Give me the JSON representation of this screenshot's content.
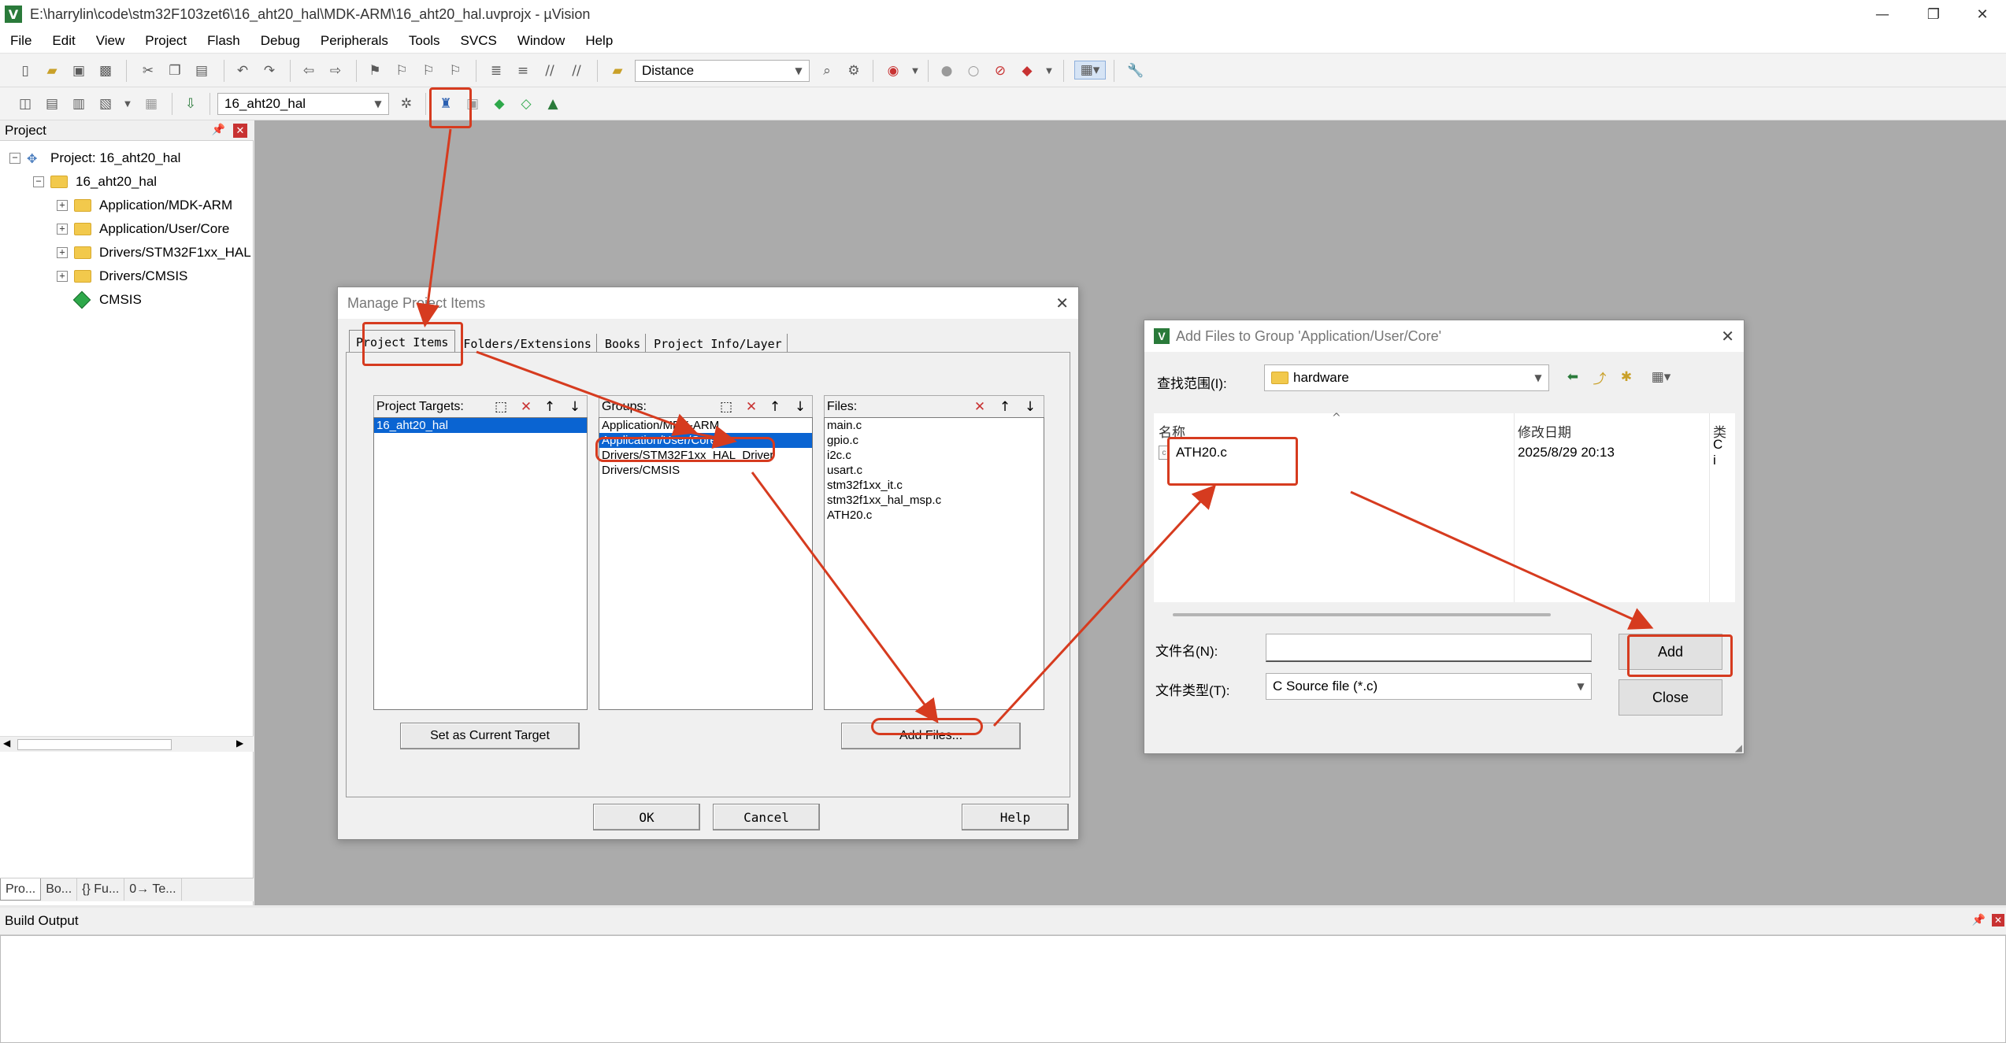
{
  "window": {
    "title": "E:\\harrylin\\code\\stm32F103zet6\\16_aht20_hal\\MDK-ARM\\16_aht20_hal.uvprojx - µVision",
    "minimize": "—",
    "restore": "❐",
    "close": "✕"
  },
  "menu": [
    "File",
    "Edit",
    "View",
    "Project",
    "Flash",
    "Debug",
    "Peripherals",
    "Tools",
    "SVCS",
    "Window",
    "Help"
  ],
  "toolbar1": {
    "find_combo": "Distance"
  },
  "toolbar2": {
    "target_combo": "16_aht20_hal"
  },
  "project_panel": {
    "title": "Project",
    "tree": {
      "root": "Project: 16_aht20_hal",
      "target": "16_aht20_hal",
      "groups": [
        "Application/MDK-ARM",
        "Application/User/Core",
        "Drivers/STM32F1xx_HAL",
        "Drivers/CMSIS"
      ],
      "component": "CMSIS"
    },
    "tabs": [
      "Pro...",
      "Bo...",
      "{} Fu...",
      "0→ Te..."
    ]
  },
  "build_output": {
    "title": "Build Output"
  },
  "manage_dialog": {
    "title": "Manage Project Items",
    "tabs": [
      "Project Items",
      "Folders/Extensions",
      "Books",
      "Project Info/Layer"
    ],
    "targets_label": "Project Targets:",
    "groups_label": "Groups:",
    "files_label": "Files:",
    "targets": [
      "16_aht20_hal"
    ],
    "groups": [
      "Application/MDK-ARM",
      "Application/User/Core",
      "Drivers/STM32F1xx_HAL_Driver",
      "Drivers/CMSIS"
    ],
    "files": [
      "main.c",
      "gpio.c",
      "i2c.c",
      "usart.c",
      "stm32f1xx_it.c",
      "stm32f1xx_hal_msp.c",
      "ATH20.c"
    ],
    "set_current_target": "Set as Current Target",
    "add_files": "Add Files...",
    "ok": "OK",
    "cancel": "Cancel",
    "help": "Help"
  },
  "add_dialog": {
    "title": "Add Files to Group 'Application/User/Core'",
    "lookin_label": "查找范围(I):",
    "lookin_value": "hardware",
    "col_name": "名称",
    "col_date": "修改日期",
    "col_type": "类",
    "file_name": "ATH20.c",
    "file_date": "2025/8/29 20:13",
    "file_type": "C i",
    "filename_label": "文件名(N):",
    "filename_value": "",
    "filetype_label": "文件类型(T):",
    "filetype_value": "C Source file (*.c)",
    "add": "Add",
    "close": "Close"
  },
  "annotation_color": "#d63b1f",
  "selection_color": "#0a64d2"
}
